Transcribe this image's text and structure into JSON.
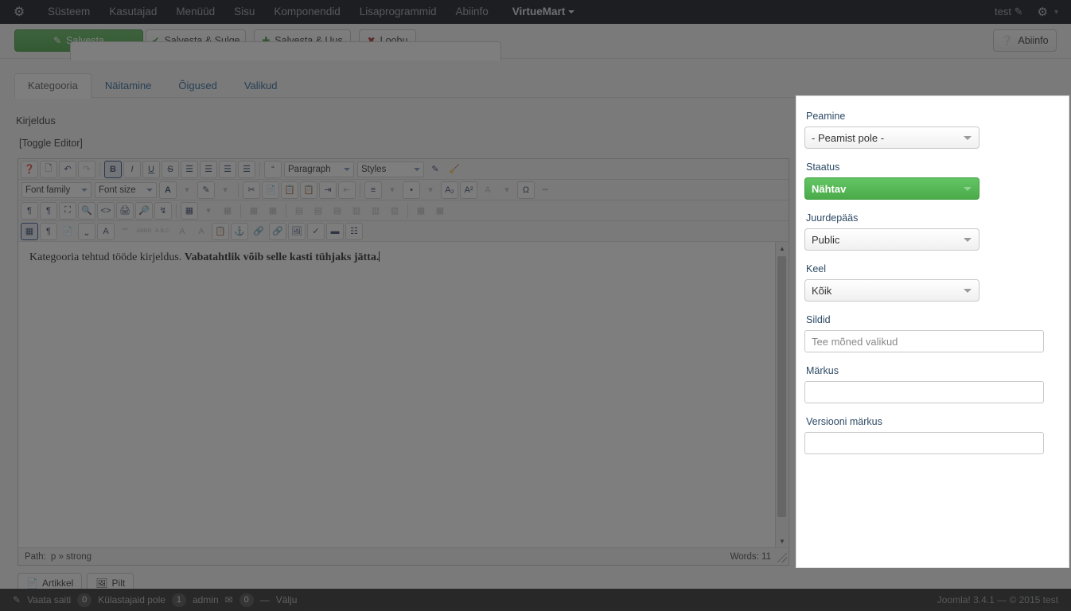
{
  "navbar": {
    "logo_icon": "joomla-logo-icon",
    "items": [
      {
        "label": "Süsteem"
      },
      {
        "label": "Kasutajad"
      },
      {
        "label": "Menüüd"
      },
      {
        "label": "Sisu"
      },
      {
        "label": "Komponendid"
      },
      {
        "label": "Lisaprogrammid"
      },
      {
        "label": "Abiinfo"
      }
    ],
    "brand": "VirtueMart",
    "user": "test",
    "user_icon": "external-link-icon",
    "gear_icon": "gear-icon",
    "caret_icon": "chevron-down-icon"
  },
  "toolbar": {
    "save": "Salvesta",
    "save_close": "Salvesta & Sulge",
    "save_new": "Salvesta & Uus",
    "cancel": "Loobu",
    "help": "Abiinfo",
    "save_icon": "pencil-square-icon",
    "save_close_icon": "check-icon",
    "save_new_icon": "plus-icon",
    "cancel_icon": "cancel-circle-icon",
    "help_icon": "question-circle-icon"
  },
  "tabs": [
    {
      "label": "Kategooria",
      "active": true
    },
    {
      "label": "Näitamine",
      "active": false
    },
    {
      "label": "Õigused",
      "active": false
    },
    {
      "label": "Valikud",
      "active": false
    }
  ],
  "editor": {
    "field_label": "Kirjeldus",
    "toggle_editor": "[Toggle Editor]",
    "font_family_select": "Font family",
    "font_size_select": "Font size",
    "paragraph_select": "Paragraph",
    "styles_select": "Styles",
    "content_plain": "Kategooria tehtud tööde kirjeldus. ",
    "content_bold": "Vabatahtlik võib selle kasti tühjaks jätta.",
    "path_label": "Path:",
    "path_value": "p » strong",
    "words_label": "Words: 11",
    "action_article": "Artikkel",
    "action_image": "Pilt",
    "action_article_icon": "article-icon",
    "action_image_icon": "image-icon",
    "toolbar_rows": [
      [
        "help-icon",
        "new-document-icon",
        "undo-icon",
        "redo-icon",
        "|",
        "bold-icon",
        "italic-icon",
        "underline-icon",
        "strikethrough-icon",
        "align-justify-icon",
        "align-center-icon",
        "align-left-icon",
        "align-right-icon",
        "|",
        "blockquote-icon"
      ],
      [
        "cut-icon",
        "copy-icon",
        "paste-icon",
        "paste-text-icon",
        "indent-icon",
        "outdent-icon",
        "numbered-list-icon",
        "bulleted-list-icon",
        "subscript-icon",
        "superscript-icon",
        "remove-format-icon",
        "special-character-icon",
        "horizontal-rule-icon"
      ],
      [
        "ltr-icon",
        "rtl-icon",
        "fullscreen-icon",
        "preview-icon",
        "source-code-icon",
        "print-icon",
        "search-icon",
        "replace-icon",
        "template-icon",
        "delete-table-icon",
        "merge-cells-icon",
        "split-cells-icon"
      ],
      [
        "visual-aid-icon",
        "show-blocks-icon",
        "pagebreak-icon",
        "nonbreaking-icon",
        "text-color-icon",
        "quote-icon",
        "abbreviation-icon",
        "acronym-icon",
        "del-icon",
        "ins-icon",
        "attributes-icon",
        "anchor-icon",
        "unlink-icon",
        "link-icon",
        "image-icon",
        "spellcheck-icon",
        "horizontal-rule-icon",
        "layer-icon"
      ]
    ]
  },
  "side_panel": {
    "fields": [
      {
        "label": "Peamine",
        "type": "select",
        "value": "- Peamist pole -",
        "name": "parent-select"
      },
      {
        "label": "Staatus",
        "type": "select-status",
        "value": "Nähtav",
        "name": "status-select"
      },
      {
        "label": "Juurdepääs",
        "type": "select",
        "value": "Public",
        "name": "access-select"
      },
      {
        "label": "Keel",
        "type": "select",
        "value": "Kõik",
        "name": "language-select"
      },
      {
        "label": "Sildid",
        "type": "input",
        "value": "",
        "placeholder": "Tee mõned valikud",
        "name": "tags-input"
      },
      {
        "label": "Märkus",
        "type": "input",
        "value": "",
        "placeholder": "",
        "name": "note-input"
      },
      {
        "label": "Versiooni märkus",
        "type": "input",
        "value": "",
        "placeholder": "",
        "name": "version-note-input"
      }
    ]
  },
  "statusbar": {
    "view_site": "Vaata saiti",
    "visitors_count": "0",
    "visitors_label": "Külastajaid pole",
    "admin_count": "1",
    "admin_label": "admin",
    "messages_icon": "envelope-icon",
    "messages_count": "0",
    "logout": "Välju",
    "logout_icon": "minus-icon",
    "view_icon": "external-link-icon",
    "copyright": "Joomla! 3.4.1  —  © 2015 test"
  },
  "colors": {
    "navbar_bg": "#0d1117",
    "accent_green": "#4bab4b",
    "status_green": "#62c462",
    "link_blue": "#2a6496",
    "statusbar_bg": "#2a2a2a",
    "dim_overlay": "rgba(40,40,40,0.60)"
  }
}
